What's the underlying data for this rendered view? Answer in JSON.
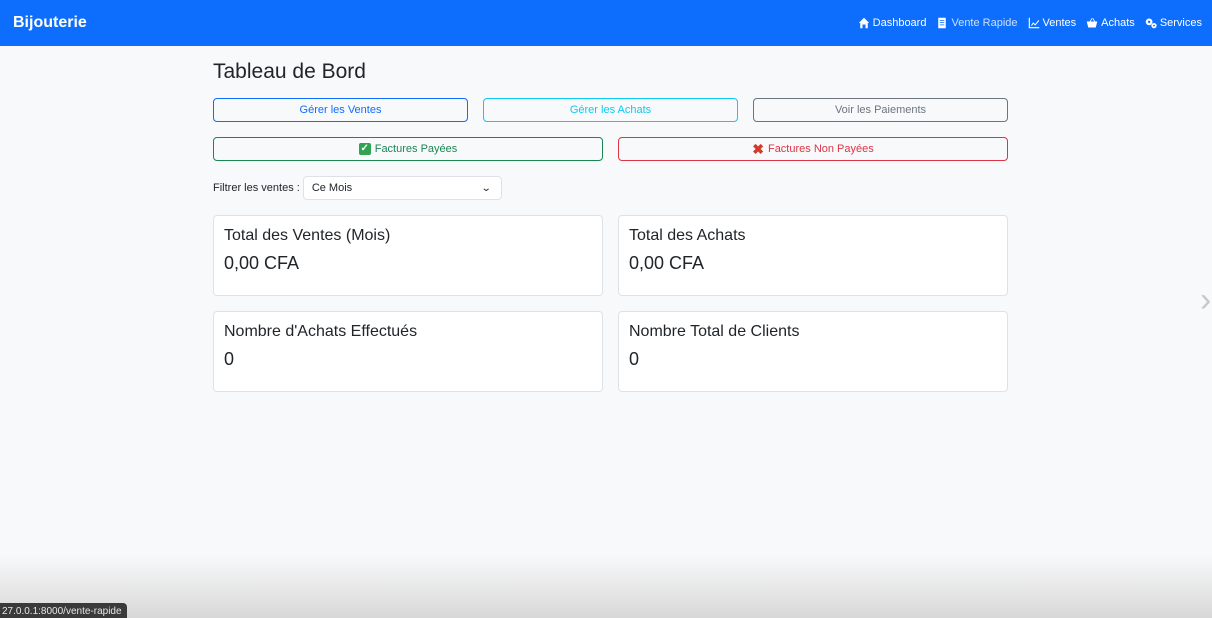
{
  "navbar": {
    "brand": "Bijouterie",
    "links": [
      {
        "label": "Dashboard",
        "icon": "home-icon"
      },
      {
        "label": "Vente Rapide",
        "icon": "receipt-icon"
      },
      {
        "label": "Ventes",
        "icon": "chart-line-icon"
      },
      {
        "label": "Achats",
        "icon": "basket-icon"
      },
      {
        "label": "Services",
        "icon": "gears-icon"
      }
    ]
  },
  "page": {
    "title": "Tableau de Bord"
  },
  "actions": {
    "manage_sales": "Gérer les Ventes",
    "manage_purchases": "Gérer les Achats",
    "view_payments": "Voir les Paiements",
    "paid_invoices": "Factures Payées",
    "unpaid_invoices": "Factures Non Payées"
  },
  "filter": {
    "label": "Filtrer les ventes :",
    "selected": "Ce Mois"
  },
  "cards": [
    {
      "title": "Total des Ventes (Mois)",
      "value": "0,00 CFA"
    },
    {
      "title": "Total des Achats",
      "value": "0,00 CFA"
    },
    {
      "title": "Nombre d'Achats Effectués",
      "value": "0"
    },
    {
      "title": "Nombre Total de Clients",
      "value": "0"
    }
  ],
  "status_bar": {
    "url": "27.0.0.1:8000/vente-rapide"
  },
  "colors": {
    "navbar": "#0d6efd",
    "primary": "#0d6efd",
    "info": "#0dcaf0",
    "secondary": "#6c757d",
    "success": "#198754",
    "danger": "#dc3545"
  }
}
